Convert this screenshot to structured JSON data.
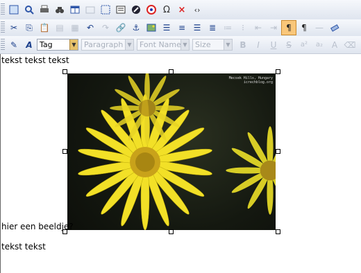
{
  "toolbar1": {
    "icons": [
      "source-icon",
      "preview-icon",
      "print-icon",
      "find-icon",
      "table-icon",
      "rule-icon",
      "select-all-icon",
      "newsletter-icon",
      "anchor-circle-icon",
      "color-icon",
      "omega-icon",
      "close-x-icon",
      "code-icon"
    ]
  },
  "toolbar2": {
    "icons": [
      "cut-icon",
      "copy-icon",
      "paste-icon",
      "paste-text-icon",
      "paste-word-icon",
      "undo-icon",
      "redo-icon",
      "link-icon",
      "anchor-icon",
      "image-icon",
      "align-left-icon",
      "align-center-icon",
      "align-right-icon",
      "justify-icon",
      "ordered-list-icon",
      "unordered-list-icon",
      "outdent-icon",
      "indent-icon",
      "show-blocks-icon",
      "pilcrow-icon",
      "hr-icon",
      "eraser-icon"
    ]
  },
  "toolbar3": {
    "tag_select": "Tag",
    "paragraph_select": "Paragraph",
    "font_select": "Font Name",
    "size_select": "Size",
    "format_buttons": [
      "B",
      "I",
      "U",
      "S",
      "a²",
      "a₂",
      "A",
      "⌫"
    ]
  },
  "editor": {
    "line1": "tekst tekst tekst",
    "line2": "hier een beeldje?",
    "line3": "tekst tekst",
    "image_caption": "Mecsek Hills, Hungary\nicrechblog.org"
  },
  "colors": {
    "accent": "#f9c77a",
    "toolbar_bg": "#e6ebf3",
    "flower": "#f2e027"
  }
}
